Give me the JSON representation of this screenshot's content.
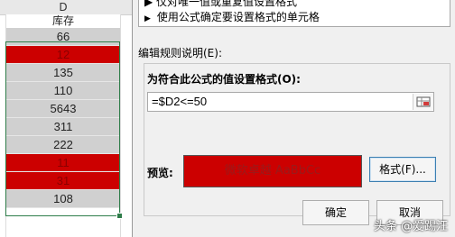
{
  "sheet": {
    "column_letter": "D",
    "header": "库存",
    "rows": [
      {
        "value": "66",
        "highlighted": false
      },
      {
        "value": "12",
        "highlighted": true
      },
      {
        "value": "135",
        "highlighted": false
      },
      {
        "value": "110",
        "highlighted": false
      },
      {
        "value": "5643",
        "highlighted": false
      },
      {
        "value": "311",
        "highlighted": false
      },
      {
        "value": "222",
        "highlighted": false
      },
      {
        "value": "11",
        "highlighted": true
      },
      {
        "value": "31",
        "highlighted": true
      },
      {
        "value": "108",
        "highlighted": false
      }
    ],
    "highlight_color": "#cc0000",
    "cell_color": "#d0d0d0",
    "selection_color": "#2f7d4a"
  },
  "dialog": {
    "rule_types": {
      "clipped_item": "▶ 仅对唯一值或重复值设置格式",
      "current_item": "使用公式确定要设置格式的单元格"
    },
    "edit_section_label": "编辑规则说明(E):",
    "formula_label": "为符合此公式的值设置格式(O):",
    "formula_value": "=$D2<=50",
    "preview_label": "预览:",
    "preview_text": "微软卓越  AaBbCc",
    "format_button": "格式(F)...",
    "ok_button": "确定",
    "cancel_button": "取消"
  },
  "watermark": "头条 @爱踢汪"
}
